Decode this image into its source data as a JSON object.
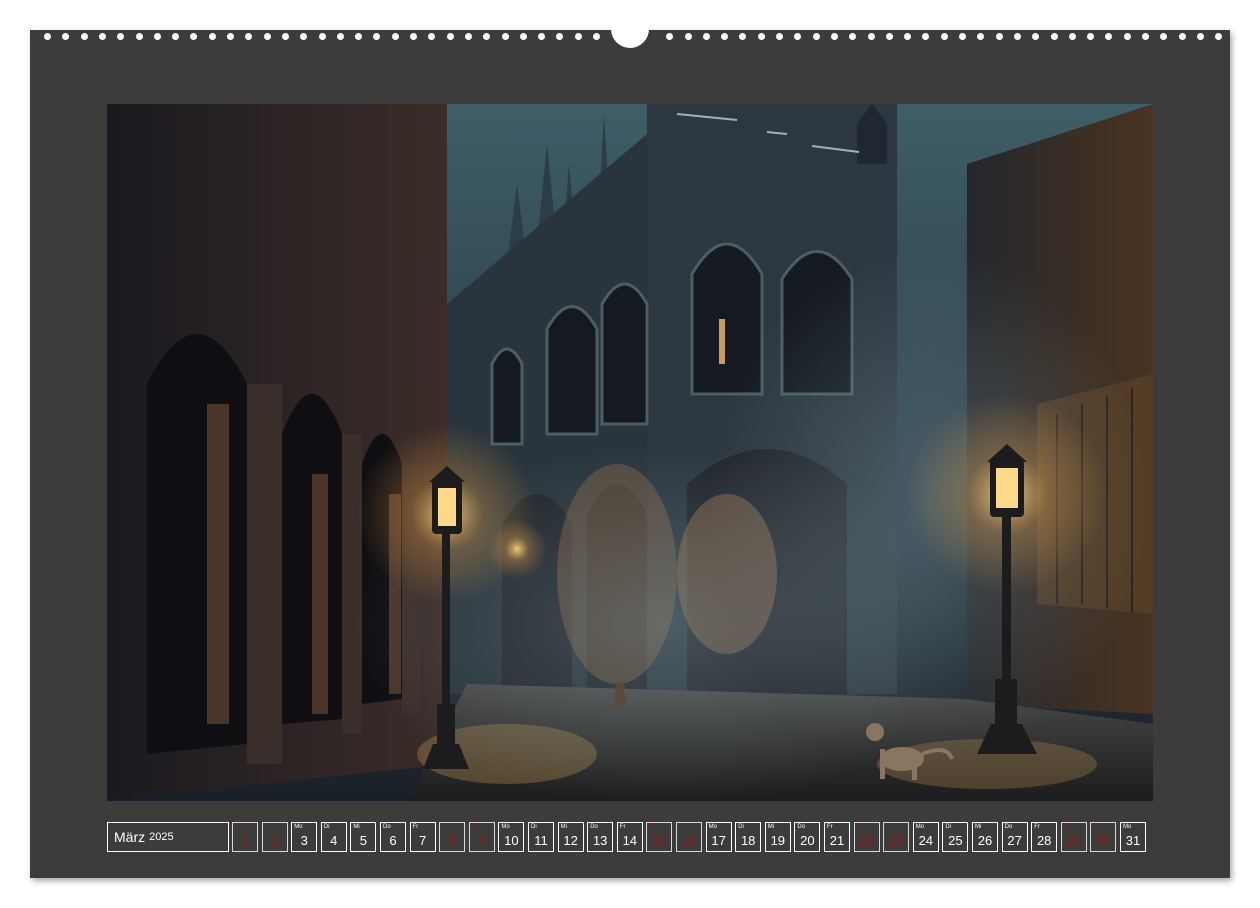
{
  "calendar": {
    "month": "März",
    "year": "2025",
    "colors": {
      "sheet": "#3c3c3c",
      "border": "#ffffff",
      "weekend_text": "#8b1a1a"
    },
    "days": [
      {
        "wd": "Sa",
        "num": "1",
        "weekend": true
      },
      {
        "wd": "So",
        "num": "2",
        "weekend": true
      },
      {
        "wd": "Mo",
        "num": "3",
        "weekend": false
      },
      {
        "wd": "Di",
        "num": "4",
        "weekend": false
      },
      {
        "wd": "Mi",
        "num": "5",
        "weekend": false
      },
      {
        "wd": "Do",
        "num": "6",
        "weekend": false
      },
      {
        "wd": "Fr",
        "num": "7",
        "weekend": false
      },
      {
        "wd": "Sa",
        "num": "8",
        "weekend": true
      },
      {
        "wd": "So",
        "num": "9",
        "weekend": true
      },
      {
        "wd": "Mo",
        "num": "10",
        "weekend": false
      },
      {
        "wd": "Di",
        "num": "11",
        "weekend": false
      },
      {
        "wd": "Mi",
        "num": "12",
        "weekend": false
      },
      {
        "wd": "Do",
        "num": "13",
        "weekend": false
      },
      {
        "wd": "Fr",
        "num": "14",
        "weekend": false
      },
      {
        "wd": "Sa",
        "num": "15",
        "weekend": true
      },
      {
        "wd": "So",
        "num": "16",
        "weekend": true
      },
      {
        "wd": "Mo",
        "num": "17",
        "weekend": false
      },
      {
        "wd": "Di",
        "num": "18",
        "weekend": false
      },
      {
        "wd": "Mi",
        "num": "19",
        "weekend": false
      },
      {
        "wd": "Do",
        "num": "20",
        "weekend": false
      },
      {
        "wd": "Fr",
        "num": "21",
        "weekend": false
      },
      {
        "wd": "Sa",
        "num": "22",
        "weekend": true
      },
      {
        "wd": "So",
        "num": "23",
        "weekend": true
      },
      {
        "wd": "Mo",
        "num": "24",
        "weekend": false
      },
      {
        "wd": "Di",
        "num": "25",
        "weekend": false
      },
      {
        "wd": "Mi",
        "num": "26",
        "weekend": false
      },
      {
        "wd": "Do",
        "num": "27",
        "weekend": false
      },
      {
        "wd": "Fr",
        "num": "28",
        "weekend": false
      },
      {
        "wd": "Sa",
        "num": "29",
        "weekend": true
      },
      {
        "wd": "So",
        "num": "30",
        "weekend": true
      },
      {
        "wd": "Mo",
        "num": "31",
        "weekend": false
      }
    ]
  },
  "photo": {
    "subject": "gothic-street-night-lanterns-cats-icon"
  }
}
